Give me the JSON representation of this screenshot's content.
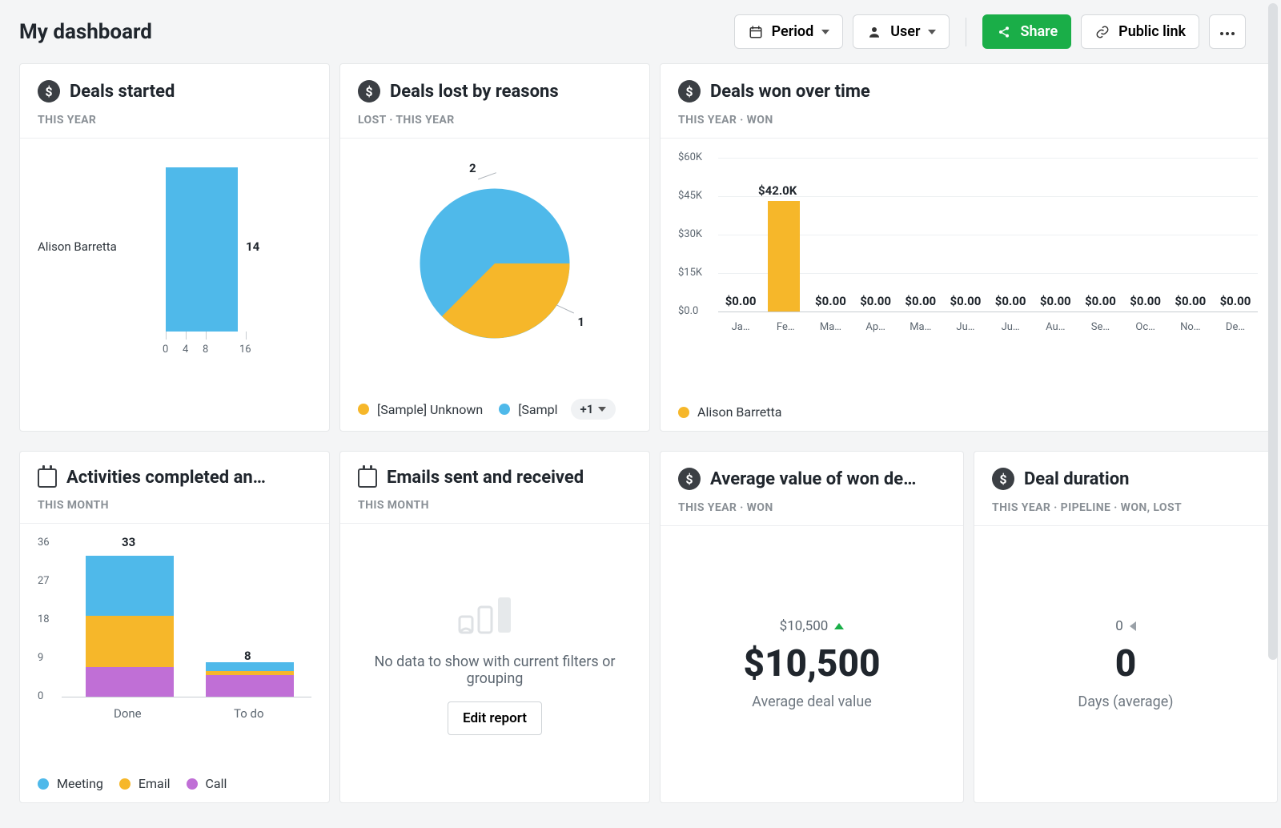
{
  "header": {
    "title": "My dashboard",
    "period_label": "Period",
    "user_label": "User",
    "share_label": "Share",
    "public_link_label": "Public link"
  },
  "cards": {
    "deals_started": {
      "title": "Deals started",
      "sub": "THIS YEAR"
    },
    "deals_lost": {
      "title": "Deals lost by reasons",
      "sub": "LOST   ·   THIS YEAR",
      "legend_a": "[Sample] Unknown",
      "legend_b": "[Sampl",
      "more": "+1",
      "slice_a": "2",
      "slice_b": "1"
    },
    "deals_won": {
      "title": "Deals won over time",
      "sub": "THIS YEAR   ·   WON",
      "legend": "Alison Barretta",
      "peak": "$42.0K"
    },
    "activities": {
      "title": "Activities completed an…",
      "sub": "THIS MONTH"
    },
    "emails": {
      "title": "Emails sent and received",
      "sub": "THIS MONTH",
      "empty_text": "No data to show with current filters or grouping",
      "edit_label": "Edit report"
    },
    "avg_value": {
      "title": "Average value of won de…",
      "sub": "THIS YEAR   ·   WON",
      "small": "$10,500",
      "big": "$10,500",
      "subtext": "Average deal value"
    },
    "duration": {
      "title": "Deal duration",
      "sub": "THIS YEAR   ·   PIPELINE   ·   WON, LOST",
      "small": "0",
      "big": "0",
      "subtext": "Days (average)"
    }
  },
  "chart_data": [
    {
      "id": "deals_started",
      "type": "bar",
      "orientation": "vertical",
      "categories": [
        "Alison Barretta"
      ],
      "values": [
        14
      ],
      "x_ticks": [
        0,
        4,
        8,
        16
      ],
      "title": "Deals started",
      "xlabel": "",
      "ylabel": "",
      "ylim": [
        0,
        16
      ],
      "series_color": "#4fb9ea"
    },
    {
      "id": "deals_lost_by_reasons",
      "type": "pie",
      "title": "Deals lost by reasons",
      "slices": [
        {
          "name": "[Sample] Unknown",
          "value": 1,
          "color": "#f6b72a"
        },
        {
          "name": "[Sample] ...",
          "value": 2,
          "color": "#4fb9ea"
        }
      ]
    },
    {
      "id": "deals_won_over_time",
      "type": "bar",
      "title": "Deals won over time",
      "categories": [
        "Ja…",
        "Fe…",
        "Ma…",
        "Ap…",
        "Ma…",
        "Ju…",
        "Ju…",
        "Au…",
        "Se…",
        "Oc…",
        "No…",
        "De…"
      ],
      "series": [
        {
          "name": "Alison Barretta",
          "values": [
            0,
            42000,
            0,
            0,
            0,
            0,
            0,
            0,
            0,
            0,
            0,
            0
          ],
          "color": "#f6b72a"
        }
      ],
      "value_labels": [
        "$0.00",
        "$42.0K",
        "$0.00",
        "$0.00",
        "$0.00",
        "$0.00",
        "$0.00",
        "$0.00",
        "$0.00",
        "$0.00",
        "$0.00",
        "$0.00"
      ],
      "y_ticks": [
        "$0.0",
        "$15K",
        "$30K",
        "$45K",
        "$60K"
      ],
      "ylim": [
        0,
        60000
      ]
    },
    {
      "id": "activities_completed",
      "type": "bar",
      "stacked": true,
      "title": "Activities completed and to do",
      "categories": [
        "Done",
        "To do"
      ],
      "series": [
        {
          "name": "Call",
          "values": [
            7,
            5
          ],
          "color": "#c06fd6"
        },
        {
          "name": "Email",
          "values": [
            12,
            1
          ],
          "color": "#f6b72a"
        },
        {
          "name": "Meeting",
          "values": [
            14,
            2
          ],
          "color": "#4fb9ea"
        }
      ],
      "totals": [
        33,
        8
      ],
      "y_ticks": [
        0,
        9,
        18,
        27,
        36
      ],
      "ylim": [
        0,
        36
      ]
    }
  ],
  "colors": {
    "blue": "#4fb9ea",
    "orange": "#f6b72a",
    "purple": "#c06fd6",
    "green": "#1aae48"
  },
  "legends": {
    "activities": {
      "a": "Meeting",
      "b": "Email",
      "c": "Call"
    }
  },
  "barchart1_label": "Alison Barretta",
  "barchart1_value": "14",
  "barchart1_ticks": {
    "a": "0",
    "b": "4",
    "c": "8",
    "d": "16"
  },
  "wonchart_ticks": {
    "a": "$60K",
    "b": "$45K",
    "c": "$30K",
    "d": "$15K",
    "e": "$0.0"
  },
  "wonchart_months": {
    "m1": "Ja…",
    "m2": "Fe…",
    "m3": "Ma…",
    "m4": "Ap…",
    "m5": "Ma…",
    "m6": "Ju…",
    "m7": "Ju…",
    "m8": "Au…",
    "m9": "Se…",
    "m10": "Oc…",
    "m11": "No…",
    "m12": "De…"
  },
  "wonchart_vals": {
    "v1": "$0.00",
    "v2": "$42.0K",
    "v3": "$0.00",
    "v4": "$0.00",
    "v5": "$0.00",
    "v6": "$0.00",
    "v7": "$0.00",
    "v8": "$0.00",
    "v9": "$0.00",
    "v10": "$0.00",
    "v11": "$0.00",
    "v12": "$0.00"
  },
  "act_ticks": {
    "a": "36",
    "b": "27",
    "c": "18",
    "d": "9",
    "e": "0"
  },
  "act_totals": {
    "a": "33",
    "b": "8"
  },
  "act_cats": {
    "a": "Done",
    "b": "To do"
  }
}
